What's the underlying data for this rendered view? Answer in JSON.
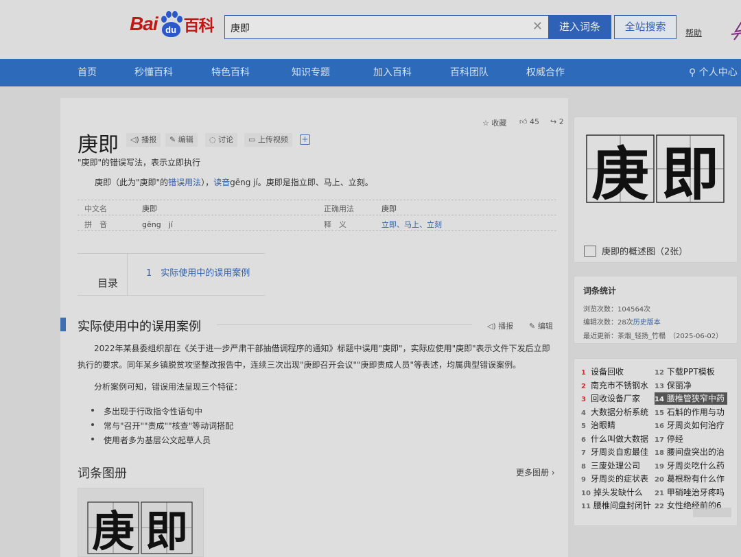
{
  "header": {
    "logo": {
      "bai": "Bai",
      "du": "du",
      "baike": "百科"
    },
    "search": {
      "value": "庚即"
    },
    "buttons": {
      "enter": "进入词条",
      "site_search": "全站搜索"
    },
    "help": "帮助"
  },
  "nav": {
    "items": [
      "首页",
      "秒懂百科",
      "特色百科",
      "知识专题",
      "加入百科",
      "百科团队",
      "权威合作"
    ],
    "user_center": "个人中心"
  },
  "entry": {
    "title": "庚即",
    "tools": [
      "播报",
      "编辑",
      "讨论",
      "上传视频"
    ],
    "actions": {
      "favorite": "收藏",
      "likes": "45",
      "shares": "2"
    },
    "subtitle": "\"庚即\"的错误写法，表示立即执行",
    "lead": {
      "p1": "庚即（此为\"庚即\"的",
      "link1": "错误用法",
      "p2": "），",
      "link2": "读音",
      "p3": "gēng jí。庚即是指立即、马上、立刻。"
    },
    "infobox": [
      {
        "label": "中文名",
        "value": "庚即",
        "label2": "正确用法",
        "value2": "庚即"
      },
      {
        "label": "拼　音",
        "value": "gēng　jí",
        "label2": "释　义",
        "value2": "立即、马上、立刻"
      }
    ],
    "toc": {
      "label": "目录",
      "items": [
        "1　实际使用中的误用案例"
      ]
    },
    "section": {
      "title": "实际使用中的误用案例",
      "tools": [
        "播报",
        "编辑"
      ],
      "para1": "2022年某县委组织部在《关于进一步严肃干部抽借调程序的通知》标题中误用\"庚即\"，实际应使用\"庚即\"表示文件下发后立即执行的要求。同年某乡镇脱贫攻坚整改报告中，连续三次出现\"庚即召开会议\"\"庚即责成人员\"等表述，均属典型错误案例。",
      "para2": "分析案例可知，错误用法呈现三个特征：",
      "bullets": [
        "多出现于行政指令性语句中",
        "常与\"召开\"\"责成\"\"核查\"等动词搭配",
        "使用者多为基层公文起草人员"
      ]
    },
    "album": {
      "title": "词条图册",
      "more": "更多图册"
    }
  },
  "sidebar": {
    "image": {
      "chars": [
        "庚",
        "即"
      ],
      "caption": "庚即的概述图（2张）"
    },
    "stats": {
      "title": "词条统计",
      "views": "浏览次数：104564次",
      "edits_prefix": "编辑次数：28次",
      "edits_link": "历史版本",
      "updated": "最近更新：茶烟_轻扬_竹榻　（2025-06-02）"
    },
    "hot": [
      {
        "n": "1",
        "t": "设备回收"
      },
      {
        "n": "2",
        "t": "南充市不锈钢水"
      },
      {
        "n": "3",
        "t": "回收设备厂家"
      },
      {
        "n": "4",
        "t": "大数据分析系统"
      },
      {
        "n": "5",
        "t": "治眼睛"
      },
      {
        "n": "6",
        "t": "什么叫做大数据"
      },
      {
        "n": "7",
        "t": "牙周炎自愈最佳"
      },
      {
        "n": "8",
        "t": "三废处理公司"
      },
      {
        "n": "9",
        "t": "牙周炎的症状表"
      },
      {
        "n": "10",
        "t": "掉头发缺什么"
      },
      {
        "n": "11",
        "t": "腰椎间盘封闭针"
      },
      {
        "n": "12",
        "t": "下载PPT模板"
      },
      {
        "n": "13",
        "t": "保丽净"
      },
      {
        "n": "14",
        "t": "腰椎管狭窄中药"
      },
      {
        "n": "15",
        "t": "石斛的作用与功"
      },
      {
        "n": "16",
        "t": "牙周炎如何治疗"
      },
      {
        "n": "17",
        "t": "停经"
      },
      {
        "n": "18",
        "t": "腰间盘突出的治"
      },
      {
        "n": "19",
        "t": "牙周炎吃什么药"
      },
      {
        "n": "20",
        "t": "葛根粉有什么作"
      },
      {
        "n": "21",
        "t": "甲硝唑治牙疼吗"
      },
      {
        "n": "22",
        "t": "女性绝经前的6"
      }
    ]
  }
}
